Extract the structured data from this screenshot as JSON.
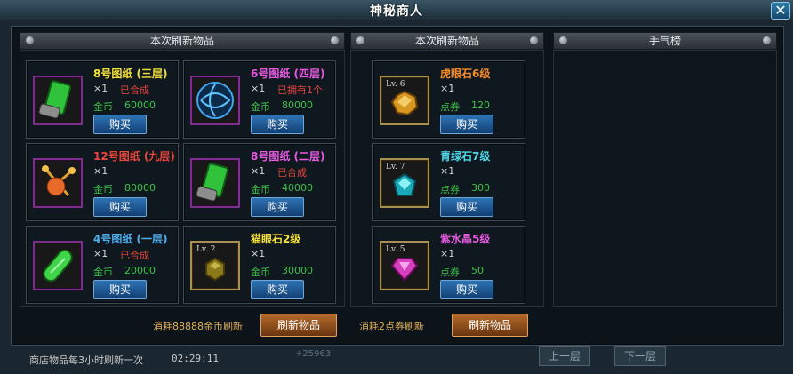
{
  "window": {
    "title": "神秘商人"
  },
  "columns": {
    "left": {
      "header": "本次刷新物品"
    },
    "middle": {
      "header": "本次刷新物品"
    },
    "right": {
      "header": "手气榜"
    }
  },
  "left_items": [
    {
      "name": "8号图纸 (三层)",
      "name_color": "#f5e23a",
      "qty": "×1",
      "status": "已合成",
      "currency": "金币",
      "price": "60000",
      "buy": "购买",
      "icon": "green-scroll-icon"
    },
    {
      "name": "6号图纸 (四层)",
      "name_color": "#e65be0",
      "qty": "×1",
      "status": "已拥有1个",
      "currency": "金币",
      "price": "80000",
      "buy": "购买",
      "icon": "blue-orb-icon"
    },
    {
      "name": "12号图纸 (九层)",
      "name_color": "#e8463a",
      "qty": "×1",
      "status": "",
      "currency": "金币",
      "price": "80000",
      "buy": "购买",
      "icon": "molecule-icon"
    },
    {
      "name": "8号图纸 (二层)",
      "name_color": "#e65be0",
      "qty": "×1",
      "status": "已合成",
      "currency": "金币",
      "price": "40000",
      "buy": "购买",
      "icon": "green-scroll-icon"
    },
    {
      "name": "4号图纸 (一层)",
      "name_color": "#4fb0f0",
      "qty": "×1",
      "status": "已合成",
      "currency": "金币",
      "price": "20000",
      "buy": "购买",
      "icon": "green-capsule-icon"
    },
    {
      "name": "猫眼石2级",
      "name_color": "#f5e23a",
      "qty": "×1",
      "status": "",
      "currency": "金币",
      "price": "30000",
      "buy": "购买",
      "icon": "catseye-stone-icon",
      "level": "Lv. 2"
    }
  ],
  "middle_items": [
    {
      "name": "虎眼石6级",
      "name_color": "#f28a2a",
      "qty": "×1",
      "currency": "点券",
      "price": "120",
      "buy": "购买",
      "icon": "tigereye-stone-icon",
      "level": "Lv. 6"
    },
    {
      "name": "青绿石7级",
      "name_color": "#4fd8e8",
      "qty": "×1",
      "currency": "点券",
      "price": "300",
      "buy": "购买",
      "icon": "cyan-stone-icon",
      "level": "Lv. 7"
    },
    {
      "name": "紫水晶5级",
      "name_color": "#e65be0",
      "qty": "×1",
      "currency": "点券",
      "price": "50",
      "buy": "购买",
      "icon": "amethyst-icon",
      "level": "Lv. 5"
    }
  ],
  "refresh": {
    "gold": {
      "text": "消耗88888金币刷新",
      "button": "刷新物品"
    },
    "points": {
      "text": "消耗2点券刷新",
      "button": "刷新物品"
    }
  },
  "footer": {
    "note": "商店物品每3小时刷新一次",
    "timer": "02:29:11",
    "background_number": "+25963",
    "prev_page": "上一层",
    "next_page": "下一层"
  }
}
